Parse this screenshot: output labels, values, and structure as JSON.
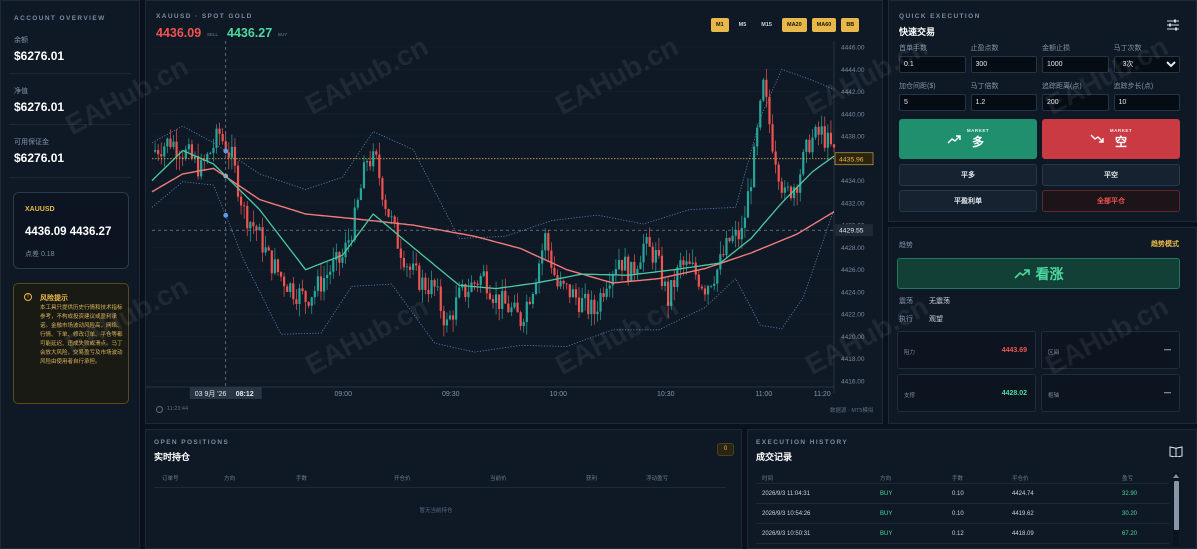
{
  "account": {
    "title": "ACCOUNT OVERVIEW",
    "rows": [
      {
        "label": "余额",
        "value": "$6276.01"
      },
      {
        "label": "净值",
        "value": "$6276.01"
      },
      {
        "label": "可用保证金",
        "value": "$6276.01"
      }
    ]
  },
  "quote_card": {
    "symbol": "XAUUSD",
    "price": "4436.09 4436.27",
    "spread": "点差 0.18"
  },
  "risk": {
    "title": "风险提示",
    "text": "本工具只提供历史行情和技术指标参考，不构成投资建议或盈利承诺。金融市场波动风险高，网络、行情、下单、修改订单、平仓等都可能延迟、违成失败或滑点。马丁会放大风险，交易盈亏及市场波动风险由使用者自行承担。"
  },
  "chart": {
    "title": "XAUUSD · SPOT GOLD",
    "bid": "4436.09",
    "bid_tag": "SELL",
    "ask": "4436.27",
    "ask_tag": "BUY",
    "timeframes": [
      "M1",
      "M5",
      "M15",
      "MA20",
      "MA60",
      "BB"
    ],
    "tf_active": [
      true,
      false,
      false,
      true,
      true,
      true
    ],
    "clock": "11:23:44",
    "footer_right": "数据源 · MT5模拟",
    "crosshair_date": "03 9月 '26",
    "crosshair_time": "08:12",
    "left_edge_label": "08"
  },
  "chart_data": {
    "type": "candlestick",
    "symbol": "XAUUSD",
    "y_ticks": [
      "4446.00",
      "4444.00",
      "4442.00",
      "4440.00",
      "4438.00",
      "4436.00",
      "4434.00",
      "4432.00",
      "4430.00",
      "4428.00",
      "4426.00",
      "4424.00",
      "4422.00",
      "4420.00",
      "4418.00",
      "4416.00"
    ],
    "x_ticks": [
      "08:30",
      "09:00",
      "09:30",
      "10:00",
      "10:30",
      "11:00",
      "11:20"
    ],
    "ylim": [
      4416,
      4446
    ],
    "price_line": 4435.96,
    "price_line_label": "4435.96",
    "crosshair_price": 4429.55,
    "crosshair_label": "4429.55",
    "overlays": [
      "MA20",
      "MA60",
      "Bollinger Bands"
    ],
    "colors": {
      "up": "#26a69a",
      "down": "#ef5350",
      "ma20": "#4cc9a0",
      "ma60": "#f07b7b",
      "bb": "#5a7fb8",
      "price": "#e8b84a"
    },
    "close_path": [
      [
        0,
        4436.6
      ],
      [
        6,
        4437.6
      ],
      [
        12,
        4436.2
      ],
      [
        16,
        4435.0
      ],
      [
        22,
        4438.2
      ],
      [
        26,
        4436.0
      ],
      [
        30,
        4431.2
      ],
      [
        34,
        4429.6
      ],
      [
        38,
        4427.0
      ],
      [
        42,
        4425.4
      ],
      [
        46,
        4424.2
      ],
      [
        50,
        4423.4
      ],
      [
        54,
        4424.5
      ],
      [
        58,
        4426.0
      ],
      [
        62,
        4427.0
      ],
      [
        66,
        4430.5
      ],
      [
        70,
        4436.0
      ],
      [
        73,
        4435.6
      ],
      [
        76,
        4432.0
      ],
      [
        80,
        4428.5
      ],
      [
        84,
        4426.0
      ],
      [
        88,
        4424.8
      ],
      [
        92,
        4424.3
      ],
      [
        96,
        4421.0
      ],
      [
        100,
        4423.6
      ],
      [
        104,
        4424.6
      ],
      [
        108,
        4425.5
      ],
      [
        112,
        4423.4
      ],
      [
        116,
        4422.6
      ],
      [
        120,
        4421.5
      ],
      [
        124,
        4424.6
      ],
      [
        128,
        4428.9
      ],
      [
        132,
        4424.5
      ],
      [
        136,
        4424.0
      ],
      [
        140,
        4423.0
      ],
      [
        144,
        4422.2
      ],
      [
        148,
        4425.2
      ],
      [
        152,
        4427.1
      ],
      [
        156,
        4425.6
      ],
      [
        160,
        4428.2
      ],
      [
        164,
        4427.2
      ],
      [
        168,
        4423.3
      ],
      [
        172,
        4426.4
      ],
      [
        176,
        4426.0
      ],
      [
        180,
        4424.5
      ],
      [
        184,
        4426.0
      ],
      [
        188,
        4428.6
      ],
      [
        192,
        4429.2
      ],
      [
        196,
        4436.0
      ],
      [
        199,
        4442.4
      ],
      [
        202,
        4437.5
      ],
      [
        206,
        4432.5
      ],
      [
        210,
        4434.0
      ],
      [
        214,
        4437.5
      ],
      [
        218,
        4438.3
      ],
      [
        222,
        4436.4
      ]
    ],
    "ma20_path": [
      [
        0,
        4434.0
      ],
      [
        10,
        4436.7
      ],
      [
        20,
        4435.5
      ],
      [
        35,
        4431.4
      ],
      [
        50,
        4426.0
      ],
      [
        62,
        4427.3
      ],
      [
        72,
        4431.0
      ],
      [
        85,
        4428.0
      ],
      [
        100,
        4424.6
      ],
      [
        112,
        4424.3
      ],
      [
        125,
        4424.8
      ],
      [
        140,
        4425.6
      ],
      [
        155,
        4425.5
      ],
      [
        170,
        4426.0
      ],
      [
        185,
        4426.6
      ],
      [
        195,
        4428.8
      ],
      [
        205,
        4432.0
      ],
      [
        215,
        4434.8
      ],
      [
        222,
        4436.2
      ]
    ],
    "ma60_path": [
      [
        0,
        4433.0
      ],
      [
        10,
        4434.6
      ],
      [
        20,
        4435.1
      ],
      [
        35,
        4432.3
      ],
      [
        50,
        4431.0
      ],
      [
        65,
        4430.6
      ],
      [
        85,
        4430.0
      ],
      [
        105,
        4429.0
      ],
      [
        120,
        4427.9
      ],
      [
        135,
        4426.0
      ],
      [
        150,
        4424.8
      ],
      [
        165,
        4425.2
      ],
      [
        180,
        4426.1
      ],
      [
        195,
        4427.5
      ],
      [
        210,
        4429.2
      ],
      [
        222,
        4431.2
      ]
    ],
    "bb_upper_path": [
      [
        0,
        4437.4
      ],
      [
        10,
        4438.9
      ],
      [
        20,
        4437.4
      ],
      [
        35,
        4434.6
      ],
      [
        50,
        4433.2
      ],
      [
        62,
        4434.3
      ],
      [
        72,
        4438.4
      ],
      [
        85,
        4436.8
      ],
      [
        100,
        4428.8
      ],
      [
        115,
        4429.0
      ],
      [
        130,
        4430.4
      ],
      [
        145,
        4430.9
      ],
      [
        160,
        4430.1
      ],
      [
        175,
        4431.4
      ],
      [
        190,
        4431.6
      ],
      [
        198,
        4439.6
      ],
      [
        205,
        4444.0
      ],
      [
        215,
        4443.0
      ],
      [
        222,
        4442.2
      ]
    ],
    "bb_lower_path": [
      [
        0,
        4431.6
      ],
      [
        10,
        4433.9
      ],
      [
        20,
        4433.6
      ],
      [
        30,
        4426.8
      ],
      [
        42,
        4420.2
      ],
      [
        55,
        4420.3
      ],
      [
        65,
        4424.5
      ],
      [
        78,
        4424.7
      ],
      [
        92,
        4419.4
      ],
      [
        105,
        4418.6
      ],
      [
        120,
        4419.2
      ],
      [
        135,
        4419.1
      ],
      [
        150,
        4420.6
      ],
      [
        165,
        4420.6
      ],
      [
        180,
        4422.6
      ],
      [
        190,
        4425.2
      ],
      [
        198,
        4421.0
      ],
      [
        205,
        4420.7
      ],
      [
        212,
        4423.5
      ],
      [
        222,
        4431.4
      ]
    ]
  },
  "quick": {
    "caption": "QUICK EXECUTION",
    "title": "快速交易",
    "fields": [
      {
        "label": "首单手数",
        "value": "0.1"
      },
      {
        "label": "止盈点数",
        "value": "300"
      },
      {
        "label": "金额止损",
        "value": "1000"
      },
      {
        "label": "马丁次数",
        "value": "3次",
        "select": true
      },
      {
        "label": "加仓间距($)",
        "value": "5"
      },
      {
        "label": "马丁倍数",
        "value": "1.2"
      },
      {
        "label": "追踪距离(点)",
        "value": "200"
      },
      {
        "label": "追踪步长(点)",
        "value": "10"
      }
    ],
    "buy": {
      "tag": "MARKET",
      "label": "多"
    },
    "sell": {
      "tag": "MARKET",
      "label": "空"
    },
    "close_long": "平多",
    "close_short": "平空",
    "close_profit": "平盈利单",
    "close_all": "全部平仓"
  },
  "trend": {
    "label": "趋势",
    "mode": "趋势模式",
    "signal": "看涨",
    "state_label": "震荡",
    "state_value": "无震荡",
    "exec_label": "执行",
    "exec_value": "观望",
    "cells": [
      {
        "label": "阻力",
        "value": "4443.69",
        "color": "#ef5350"
      },
      {
        "label": "区间",
        "value": "—",
        "color": "#c9d3e0"
      },
      {
        "label": "支撑",
        "value": "4428.02",
        "color": "#4cd9a0"
      },
      {
        "label": "枢轴",
        "value": "—",
        "color": "#c9d3e0"
      }
    ]
  },
  "positions": {
    "caption": "OPEN POSITIONS",
    "title": "实时持仓",
    "count": "0",
    "columns": [
      "订单号",
      "方向",
      "手数",
      "开仓价",
      "当前价",
      "获利",
      "浮动盈亏"
    ],
    "empty": "暂无当前持仓"
  },
  "history": {
    "caption": "EXECUTION HISTORY",
    "title": "成交记录",
    "columns": [
      "时间",
      "方向",
      "手数",
      "平仓价",
      "盈亏"
    ],
    "rows": [
      [
        "2026/9/3 11:04:31",
        "BUY",
        "0.10",
        "4424.74",
        "32.90"
      ],
      [
        "2026/9/3 10:54:26",
        "BUY",
        "0.10",
        "4419.62",
        "30.20"
      ],
      [
        "2026/9/3 10:50:31",
        "BUY",
        "0.12",
        "4418.09",
        "67.20"
      ]
    ]
  },
  "watermark": "EAHub.cn"
}
